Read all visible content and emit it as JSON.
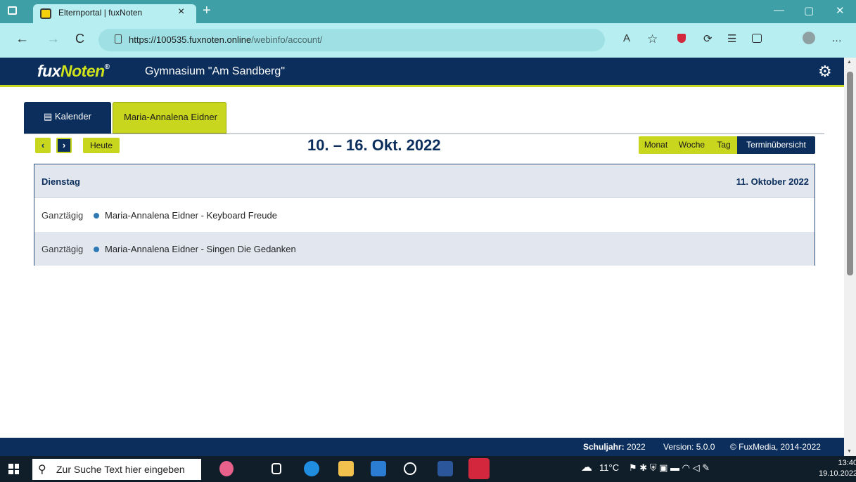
{
  "browser": {
    "tab_title": "Elternportal | fuxNoten",
    "close_glyph": "×",
    "new_tab_glyph": "+",
    "url_main": "https://100535.fuxnoten.online",
    "url_path": "/webinfo/account/",
    "window_controls": {
      "minimize": "—",
      "maximize": "▢",
      "close": "✕"
    },
    "nav": {
      "back": "←",
      "forward": "→",
      "refresh": "C"
    },
    "ext_icons": {
      "read_aloud": "A",
      "favorite": "☆",
      "extensions": "⟳",
      "collections": "☰",
      "more": "…"
    }
  },
  "app": {
    "logo_fux": "fux",
    "logo_noten": "Noten",
    "logo_reg": "®",
    "school_name": "Gymnasium \"Am Sandberg\"",
    "settings_glyph": "⚙"
  },
  "tabs": {
    "calendar_icon": "▤",
    "calendar_label": "Kalender",
    "person_label": "Maria-Annalena Eidner"
  },
  "toolbar": {
    "prev_glyph": "‹",
    "next_glyph": "›",
    "today_label": "Heute",
    "date_range": "10. – 16. Okt. 2022",
    "views": [
      "Monat",
      "Woche",
      "Tag",
      "Terminübersicht"
    ],
    "active_view": "Terminübersicht"
  },
  "schedule": {
    "day_name": "Dienstag",
    "day_date": "11. Oktober 2022",
    "events": [
      {
        "time": "Ganztägig",
        "title": "Maria-Annalena Eidner - Keyboard Freude"
      },
      {
        "time": "Ganztägig",
        "title": "Maria-Annalena Eidner - Singen Die Gedanken"
      }
    ],
    "event_color": "#2e79b3"
  },
  "footer": {
    "school_year_label": "Schuljahr:",
    "school_year": "2022",
    "version": "Version: 5.0.0",
    "copyright": "© FuxMedia, 2014-2022"
  },
  "taskbar": {
    "search_placeholder": "Zur Suche Text hier eingeben",
    "search_glyph": "⚲",
    "temperature": "11°C",
    "time": "13:40",
    "date": "19.10.2022"
  },
  "colors": {
    "navy": "#0b2e5c",
    "lime": "#c8d61e",
    "browser_teal": "#3f9fa6",
    "browser_light": "#b7eef1"
  }
}
